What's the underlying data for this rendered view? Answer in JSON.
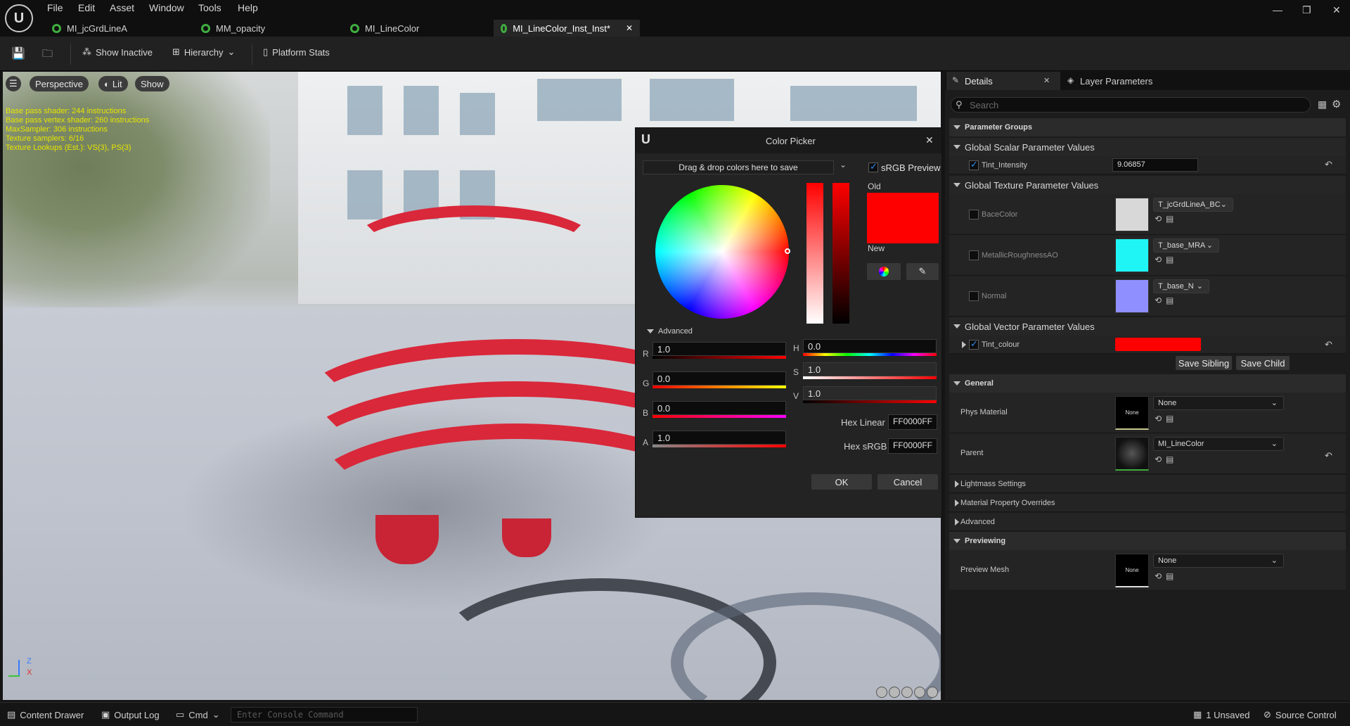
{
  "menu": {
    "file": "File",
    "edit": "Edit",
    "asset": "Asset",
    "window": "Window",
    "tools": "Tools",
    "help": "Help"
  },
  "tabs": [
    {
      "label": "MI_jcGrdLineA"
    },
    {
      "label": "MM_opacity"
    },
    {
      "label": "MI_LineColor"
    },
    {
      "label": "MI_LineColor_Inst_Inst*"
    }
  ],
  "toolbar": {
    "show_inactive": "Show Inactive",
    "hierarchy": "Hierarchy",
    "platform_stats": "Platform Stats"
  },
  "viewport": {
    "perspective": "Perspective",
    "lit": "Lit",
    "show": "Show",
    "stats": [
      "Base pass shader: 244 instructions",
      "Base pass vertex shader: 260 instructions",
      "MaxSampler: 306 instructions",
      "Texture samplers: 6/16",
      "Texture Lookups (Est.): VS(3), PS(3)"
    ],
    "axis_z": "Z",
    "axis_x": "X"
  },
  "color_picker": {
    "title": "Color Picker",
    "drop_hint": "Drag & drop colors here to save",
    "srgb_preview": "sRGB Preview",
    "old": "Old",
    "new": "New",
    "advanced": "Advanced",
    "r_label": "R",
    "g_label": "G",
    "b_label": "B",
    "a_label": "A",
    "h_label": "H",
    "s_label": "S",
    "v_label": "V",
    "r": "1.0",
    "g": "0.0",
    "b": "0.0",
    "a": "1.0",
    "h": "0.0",
    "s": "1.0",
    "v": "1.0",
    "hex_linear_label": "Hex Linear",
    "hex_linear": "FF0000FF",
    "hex_srgb_label": "Hex sRGB",
    "hex_srgb": "FF0000FF",
    "ok": "OK",
    "cancel": "Cancel",
    "old_color": "#ff0000",
    "new_color": "#ff0000"
  },
  "details": {
    "tab_details": "Details",
    "tab_layer": "Layer Parameters",
    "search_placeholder": "Search",
    "parameter_groups": "Parameter Groups",
    "scalar_group": "Global Scalar Parameter Values",
    "tint_intensity_label": "Tint_Intensity",
    "tint_intensity_value": "9.06857",
    "texture_group": "Global Texture Parameter Values",
    "base_color_label": "BaceColor",
    "base_color_tex": "T_jcGrdLineA_BC",
    "metallic_label": "MetallicRoughnessAO",
    "metallic_tex": "T_base_MRA",
    "normal_label": "Normal",
    "normal_tex": "T_base_N",
    "vector_group": "Global Vector Parameter Values",
    "tint_colour_label": "Tint_colour",
    "tint_colour": "#ff0000",
    "save_sibling": "Save Sibling",
    "save_child": "Save Child",
    "general": "General",
    "phys_material_label": "Phys Material",
    "phys_material_value": "None",
    "none_thumb": "None",
    "parent_label": "Parent",
    "parent_value": "MI_LineColor",
    "lightmass": "Lightmass Settings",
    "mat_prop_overrides": "Material Property Overrides",
    "advanced": "Advanced",
    "previewing": "Previewing",
    "preview_mesh_label": "Preview Mesh",
    "preview_mesh_value": "None"
  },
  "bottom": {
    "content_drawer": "Content Drawer",
    "output_log": "Output Log",
    "cmd": "Cmd",
    "console_placeholder": "Enter Console Command",
    "unsaved": "1 Unsaved",
    "source_control": "Source Control"
  }
}
